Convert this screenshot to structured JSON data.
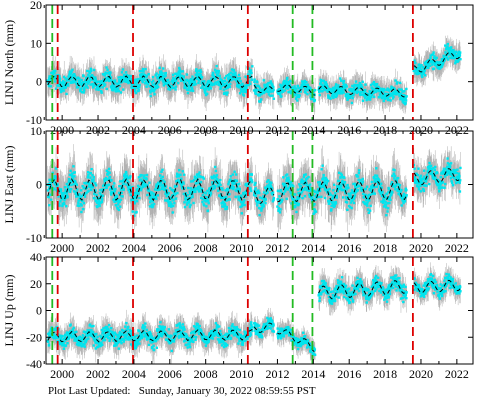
{
  "footer": "Plot Last Updated:   Sunday, January 30, 2022 08:59:55 PST",
  "chart_data": [
    {
      "type": "scatter",
      "ylabel": "LINJ North (mm)",
      "xlim": [
        1999.1,
        2022.9
      ],
      "ylim": [
        -10,
        20
      ],
      "yticks": [
        -10,
        0,
        10,
        20
      ],
      "xticks": [
        2000,
        2002,
        2004,
        2006,
        2008,
        2010,
        2012,
        2014,
        2016,
        2018,
        2020,
        2022
      ],
      "segments": [
        {
          "x": [
            1999.2,
            2010.6
          ],
          "y": [
            0.0,
            0.0
          ],
          "amp": 1.5,
          "noise": 3.5
        },
        {
          "x": [
            2010.7,
            2011.8
          ],
          "y": [
            -1.5,
            -2.5
          ],
          "amp": 1.0,
          "noise": 3.0
        },
        {
          "x": [
            2012.0,
            2014.1
          ],
          "y": [
            -1.5,
            -2.5
          ],
          "amp": 1.0,
          "noise": 3.0
        },
        {
          "x": [
            2014.3,
            2019.2
          ],
          "y": [
            -2.0,
            -3.0
          ],
          "amp": 1.0,
          "noise": 3.0
        },
        {
          "x": [
            2019.6,
            2022.2
          ],
          "y": [
            3.0,
            7.5
          ],
          "amp": 1.2,
          "noise": 3.0
        }
      ],
      "series": [
        {
          "name": "observed",
          "color": "#00e5ee"
        },
        {
          "name": "error",
          "color": "#b0b0b0"
        },
        {
          "name": "model",
          "color": "#000000"
        }
      ]
    },
    {
      "type": "scatter",
      "ylabel": "LINJ East (mm)",
      "xlim": [
        1999.1,
        2022.9
      ],
      "ylim": [
        -10,
        10
      ],
      "yticks": [
        -10,
        0,
        10
      ],
      "xticks": [
        2000,
        2002,
        2004,
        2006,
        2008,
        2010,
        2012,
        2014,
        2016,
        2018,
        2020,
        2022
      ],
      "segments": [
        {
          "x": [
            1999.2,
            2010.6
          ],
          "y": [
            -1.0,
            -1.0
          ],
          "amp": 2.0,
          "noise": 3.5
        },
        {
          "x": [
            2010.7,
            2011.8
          ],
          "y": [
            -2.0,
            -2.0
          ],
          "amp": 1.5,
          "noise": 3.0
        },
        {
          "x": [
            2012.0,
            2019.2
          ],
          "y": [
            -1.5,
            -1.0
          ],
          "amp": 1.8,
          "noise": 3.5
        },
        {
          "x": [
            2019.6,
            2022.2
          ],
          "y": [
            1.0,
            2.0
          ],
          "amp": 1.2,
          "noise": 3.0
        }
      ],
      "series": [
        {
          "name": "observed",
          "color": "#00e5ee"
        },
        {
          "name": "error",
          "color": "#b0b0b0"
        },
        {
          "name": "model",
          "color": "#000000"
        }
      ]
    },
    {
      "type": "scatter",
      "ylabel": "LINJ Up (mm)",
      "xlim": [
        1999.1,
        2022.9
      ],
      "ylim": [
        -40,
        40
      ],
      "yticks": [
        -40,
        -20,
        0,
        20,
        40
      ],
      "xticks": [
        2000,
        2002,
        2004,
        2006,
        2008,
        2010,
        2012,
        2014,
        2016,
        2018,
        2020,
        2022
      ],
      "segments": [
        {
          "x": [
            1999.2,
            2010.6
          ],
          "y": [
            -20.0,
            -18.0
          ],
          "amp": 4.0,
          "noise": 9
        },
        {
          "x": [
            2010.7,
            2011.8
          ],
          "y": [
            -14.0,
            -12.0
          ],
          "amp": 3.0,
          "noise": 7
        },
        {
          "x": [
            2012.0,
            2014.1
          ],
          "y": [
            -14.0,
            -28.0
          ],
          "amp": 3.0,
          "noise": 7
        },
        {
          "x": [
            2014.3,
            2019.2
          ],
          "y": [
            13.0,
            18.0
          ],
          "amp": 5.0,
          "noise": 9
        },
        {
          "x": [
            2019.6,
            2022.2
          ],
          "y": [
            17.0,
            19.0
          ],
          "amp": 4.0,
          "noise": 8
        }
      ],
      "series": [
        {
          "name": "observed",
          "color": "#00e5ee"
        },
        {
          "name": "error",
          "color": "#b0b0b0"
        },
        {
          "name": "model",
          "color": "#000000"
        }
      ]
    }
  ],
  "events": {
    "red": [
      1999.75,
      2003.95,
      2010.35,
      2019.55
    ],
    "green": [
      1999.45,
      2012.85,
      2013.95
    ],
    "colors": {
      "red": "#dd0000",
      "green": "#22bb22"
    }
  }
}
